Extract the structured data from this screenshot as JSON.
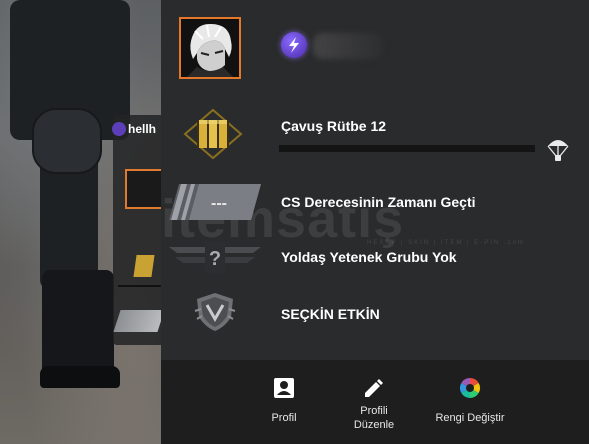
{
  "ghost_panel": {
    "name_fragment": "hellh"
  },
  "profile": {
    "badge_icon": "lightning-bolt-icon",
    "name": ""
  },
  "rank": {
    "title": "Çavuş Rütbe 12",
    "progress_fraction": 0.0,
    "icon": "rank-chevrons-icon",
    "reward_icon": "parachute-icon"
  },
  "cs_rating": {
    "text": "CS Derecesinin Zamanı Geçti",
    "icon_text": "---"
  },
  "skill_group": {
    "text": "Yoldaş Yetenek Grubu Yok",
    "icon_text": "?"
  },
  "elite": {
    "text": "SEÇKİN ETKİN",
    "icon": "elite-shield-icon"
  },
  "watermark": {
    "text": "itemsatış",
    "sub": "HESAP | SKIN | ITEM | E-PIN .com"
  },
  "actions": [
    {
      "label": "Profil",
      "icon": "person-card-icon"
    },
    {
      "label": "Profili Düzenle",
      "icon": "pencil-icon"
    },
    {
      "label": "Rengi Değiştir",
      "icon": "color-wheel-icon"
    }
  ],
  "colors": {
    "accent_orange": "#e3782a",
    "panel_bg": "#2a2b2c",
    "rank_gold": "#d4a72c",
    "badge_purple": "#6b4de0"
  }
}
